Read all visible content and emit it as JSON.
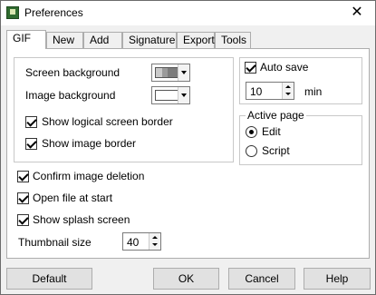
{
  "window": {
    "title": "Preferences",
    "close_glyph": "✕"
  },
  "tabs": [
    {
      "label": "GIF"
    },
    {
      "label": "New"
    },
    {
      "label": "Add"
    },
    {
      "label": "Signature"
    },
    {
      "label": "Export"
    },
    {
      "label": "Tools"
    }
  ],
  "gif": {
    "screen_background": {
      "label": "Screen background"
    },
    "image_background": {
      "label": "Image background"
    },
    "show_logical_border": {
      "label": "Show logical screen border",
      "checked": true
    },
    "show_image_border": {
      "label": "Show image border",
      "checked": true
    },
    "auto_save": {
      "label": "Auto save",
      "checked": true,
      "value": "10",
      "unit": "min"
    },
    "active_page": {
      "title": "Active page",
      "options": [
        {
          "label": "Edit",
          "selected": true
        },
        {
          "label": "Script",
          "selected": false
        }
      ]
    },
    "confirm_deletion": {
      "label": "Confirm image deletion",
      "checked": true
    },
    "open_file_at_start": {
      "label": "Open file at start",
      "checked": true
    },
    "show_splash": {
      "label": "Show splash screen",
      "checked": true
    },
    "thumbnail_size": {
      "label": "Thumbnail size",
      "value": "40"
    }
  },
  "buttons": {
    "default": "Default",
    "ok": "OK",
    "cancel": "Cancel",
    "help": "Help"
  }
}
